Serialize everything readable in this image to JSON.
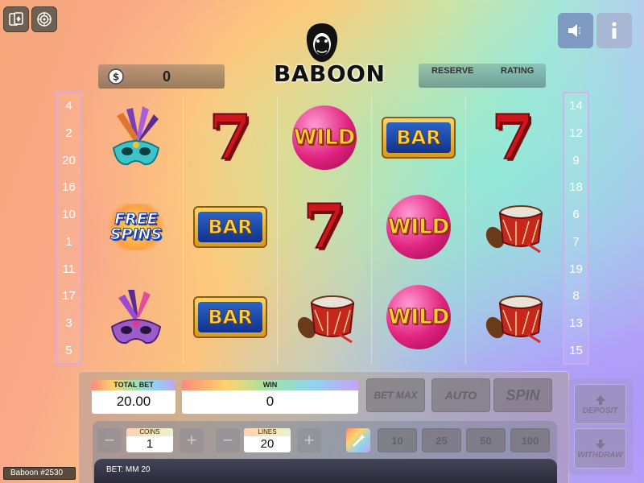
{
  "header": {
    "logo_text": "BABOON",
    "coins_value": "0",
    "reserve_label": "RESERVE",
    "rating_label": "RATING"
  },
  "top_left_icons": [
    "cards-icon",
    "settings-wheel-icon"
  ],
  "top_right_icons": [
    "speaker-icon",
    "info-icon"
  ],
  "left_paylines": [
    "4",
    "2",
    "20",
    "16",
    "10",
    "1",
    "11",
    "17",
    "3",
    "5"
  ],
  "right_paylines": [
    "14",
    "12",
    "9",
    "18",
    "6",
    "7",
    "19",
    "8",
    "13",
    "15"
  ],
  "reels": [
    [
      "mask-gold",
      "free-spins",
      "mask-purple"
    ],
    [
      "seven",
      "bar",
      "bar"
    ],
    [
      "wild",
      "seven",
      "drum"
    ],
    [
      "bar",
      "wild",
      "wild"
    ],
    [
      "seven",
      "drum",
      "drum"
    ]
  ],
  "symbol_text": {
    "bar": "BAR",
    "wild": "WILD",
    "seven": "7",
    "free_line1": "FREE",
    "free_line2": "SPINS"
  },
  "controls": {
    "total_bet_label": "TOTAL BET",
    "total_bet_value": "20.00",
    "win_label": "WIN",
    "win_value": "0",
    "bet_max_label": "BET MAX",
    "auto_label": "AUTO",
    "spin_label": "SPIN",
    "coins_label": "COINS",
    "coins_value": "1",
    "lines_label": "LINES",
    "lines_value": "20",
    "quick_bets": [
      "10",
      "25",
      "50",
      "100"
    ],
    "deposit_label": "DEPOSIT",
    "withdraw_label": "WITHDRAW",
    "bet_info": "BET: MM 20"
  },
  "game_badge": "Baboon #2530",
  "colors": {
    "accent_blue": "#7f9ac2",
    "seven_red": "#d0141c",
    "wild_pink": "#e0227e",
    "bar_blue": "#12328a"
  }
}
